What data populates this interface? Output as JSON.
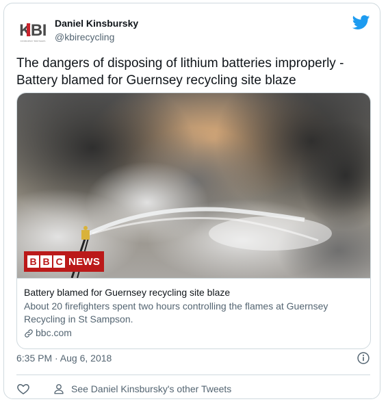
{
  "author": {
    "name": "Daniel Kinsbursky",
    "handle": "@kbirecycling",
    "avatar_text": "KBI",
    "avatar_subtext": "KINSBURSKY BROTHERS"
  },
  "tweet": {
    "text": "The dangers of disposing of lithium batteries improperly - Battery blamed for Guernsey recycling site blaze"
  },
  "link_card": {
    "badge_letters": [
      "B",
      "B",
      "C"
    ],
    "badge_word": "NEWS",
    "title": "Battery blamed for Guernsey recycling site blaze",
    "description": "About 20 firefighters spent two hours controlling the flames at Guernsey Recycling in St Sampson.",
    "domain": "bbc.com"
  },
  "meta": {
    "timestamp": "6:35 PM · Aug 6, 2018"
  },
  "actions": {
    "other_tweets_label": "See Daniel Kinsbursky's other Tweets"
  },
  "icons": {
    "brand": "twitter-bird-icon",
    "link": "link-icon",
    "info": "info-icon",
    "like": "heart-icon",
    "profile": "person-icon"
  },
  "colors": {
    "twitter_blue": "#1d9bf0",
    "kbi_red": "#c8232c",
    "kbi_gray": "#4a4a4a",
    "bbc_red": "#bb1919",
    "secondary_text": "#536471",
    "border": "#cfd9de"
  }
}
